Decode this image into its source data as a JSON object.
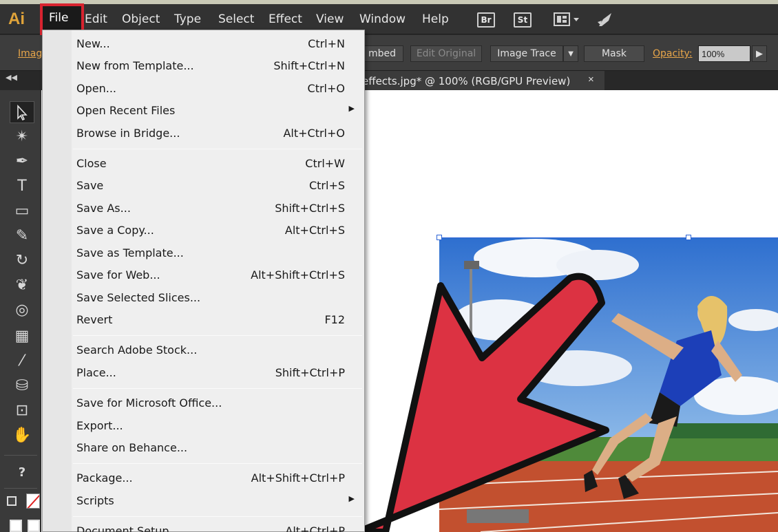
{
  "app": {
    "logo": "Ai"
  },
  "menubar": {
    "items": [
      {
        "label": "File"
      },
      {
        "label": "Edit"
      },
      {
        "label": "Object"
      },
      {
        "label": "Type"
      },
      {
        "label": "Select"
      },
      {
        "label": "Effect"
      },
      {
        "label": "View"
      },
      {
        "label": "Window"
      },
      {
        "label": "Help"
      }
    ],
    "bridge_icon": "Br",
    "stock_icon": "St",
    "workspace_icon": "workspace-switcher-icon",
    "sync_icon": "rocket-icon"
  },
  "controlbar": {
    "image_label": "Imag",
    "embed_label": "mbed",
    "edit_original_label": "Edit Original",
    "image_trace_label": "Image Trace",
    "mask_label": "Mask",
    "opacity_label": "Opacity:",
    "opacity_value": "100%"
  },
  "document_tab": {
    "title": "effects.jpg* @ 100% (RGB/GPU Preview)",
    "close": "×"
  },
  "file_menu": {
    "items": [
      {
        "label": "New...",
        "shortcut": "Ctrl+N"
      },
      {
        "label": "New from Template...",
        "shortcut": "Shift+Ctrl+N"
      },
      {
        "label": "Open...",
        "shortcut": "Ctrl+O"
      },
      {
        "label": "Open Recent Files",
        "shortcut": "",
        "submenu": true
      },
      {
        "label": "Browse in Bridge...",
        "shortcut": "Alt+Ctrl+O"
      },
      {
        "label": "Close",
        "shortcut": "Ctrl+W"
      },
      {
        "label": "Save",
        "shortcut": "Ctrl+S"
      },
      {
        "label": "Save As...",
        "shortcut": "Shift+Ctrl+S"
      },
      {
        "label": "Save a Copy...",
        "shortcut": "Alt+Ctrl+S"
      },
      {
        "label": "Save as Template...",
        "shortcut": ""
      },
      {
        "label": "Save for Web...",
        "shortcut": "Alt+Shift+Ctrl+S"
      },
      {
        "label": "Save Selected Slices...",
        "shortcut": ""
      },
      {
        "label": "Revert",
        "shortcut": "F12"
      },
      {
        "label": "Search Adobe Stock...",
        "shortcut": ""
      },
      {
        "label": "Place...",
        "shortcut": "Shift+Ctrl+P"
      },
      {
        "label": "Save for Microsoft Office...",
        "shortcut": ""
      },
      {
        "label": "Export...",
        "shortcut": ""
      },
      {
        "label": "Share on Behance...",
        "shortcut": ""
      },
      {
        "label": "Package...",
        "shortcut": "Alt+Shift+Ctrl+P"
      },
      {
        "label": "Scripts",
        "shortcut": "",
        "submenu": true
      },
      {
        "label": "Document Setup...",
        "shortcut": "Alt+Ctrl+P"
      }
    ],
    "submenu_glyph": "▶"
  },
  "colors": {
    "highlight_box": "#d8232f",
    "arrow_fill": "#dc3242",
    "arrow_stroke": "#111111",
    "ai_logo": "#e0a43a"
  }
}
